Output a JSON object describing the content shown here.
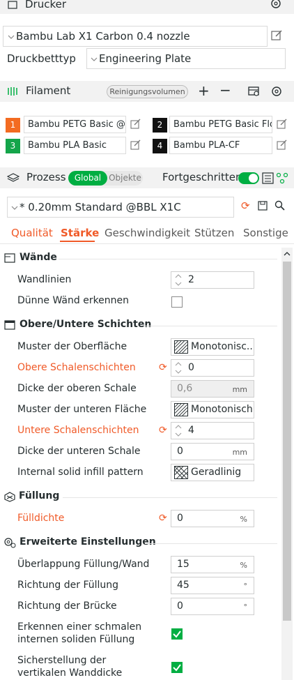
{
  "printer": {
    "header_label": "Drucker",
    "printer_value": "Bambu Lab X1 Carbon 0.4 nozzle",
    "bed_label": "Druckbetttyp",
    "bed_value": "Engineering Plate"
  },
  "filament": {
    "header_label": "Filament",
    "purge_button": "Reinigungsvolumen",
    "slots": [
      {
        "num": "1",
        "name": "Bambu PETG Basic @...",
        "color": "#f36b21"
      },
      {
        "num": "2",
        "name": "Bambu PETG Basic Flo...",
        "color": "#111111"
      },
      {
        "num": "3",
        "name": "Bambu PLA Basic",
        "color": "#14a54a"
      },
      {
        "num": "4",
        "name": "Bambu PLA-CF",
        "color": "#111111"
      }
    ]
  },
  "process": {
    "header_label": "Prozess",
    "toggle_global": "Global",
    "toggle_objects": "Objekte",
    "advanced_label": "Fortgeschritten",
    "preset_value": "* 0.20mm Standard @BBL X1C",
    "tabs": [
      "Qualität",
      "Stärke",
      "Geschwindigkeit",
      "Stützen",
      "Sonstige"
    ]
  },
  "sections": {
    "walls": {
      "title": "Wände",
      "wall_loops_label": "Wandlinien",
      "wall_loops_value": "2",
      "thin_walls_label": "Dünne Wänd erkennen"
    },
    "shells": {
      "title": "Obere/Untere Schichten",
      "top_pattern_label": "Muster der Oberfläche",
      "top_pattern_value": "Monotonisc...",
      "top_layers_label": "Obere Schalenschichten",
      "top_layers_value": "0",
      "top_thickness_label": "Dicke der oberen Schale",
      "top_thickness_value": "0,6",
      "bottom_pattern_label": "Muster der unteren Fläche",
      "bottom_pattern_value": "Monotonisch",
      "bottom_layers_label": "Untere Schalenschichten",
      "bottom_layers_value": "4",
      "bottom_thickness_label": "Dicke der unteren Schale",
      "bottom_thickness_value": "0",
      "solid_infill_label": "Internal solid infill pattern",
      "solid_infill_value": "Geradlinig",
      "unit_mm": "mm"
    },
    "infill": {
      "title": "Füllung",
      "density_label": "Fülldichte",
      "density_value": "0",
      "unit_pct": "%"
    },
    "advanced": {
      "title": "Erweiterte Einstellungen",
      "overlap_label": "Überlappung Füllung/Wand",
      "overlap_value": "15",
      "unit_pct": "%",
      "direction_label": "Richtung der Füllung",
      "direction_value": "45",
      "bridge_label": "Richtung der Brücke",
      "bridge_value": "0",
      "unit_deg": "°",
      "narrow_label_1": "Erkennen einer schmalen",
      "narrow_label_2": "internen soliden Füllung",
      "ensure_label_1": "Sicherstellung der",
      "ensure_label_2": "vertikalen Wanddicke"
    }
  },
  "colors": {
    "accent_green": "#00ae42",
    "changed_orange": "#f05a28"
  }
}
